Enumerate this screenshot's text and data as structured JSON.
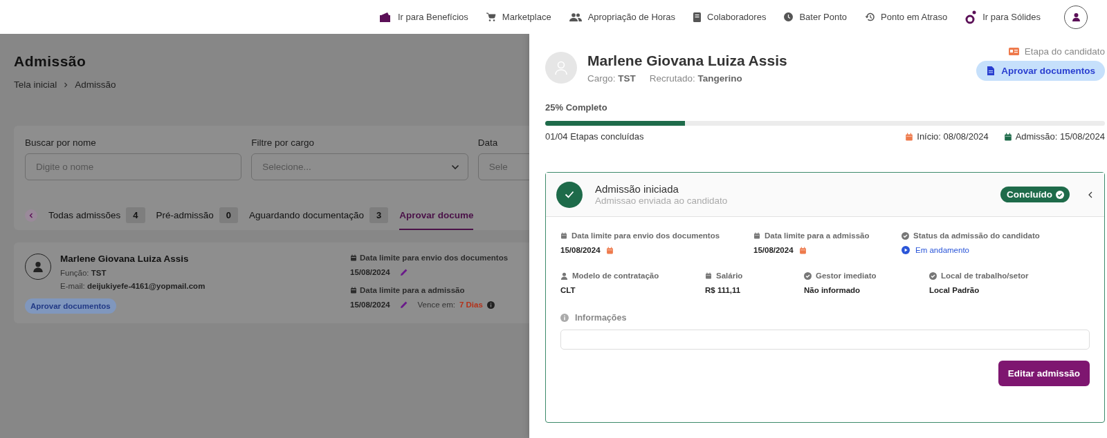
{
  "top_nav": {
    "links": [
      {
        "label": "Ir para Benefícios"
      },
      {
        "label": "Marketplace"
      },
      {
        "label": "Apropriação de Horas"
      },
      {
        "label": "Colaboradores"
      },
      {
        "label": "Bater Ponto"
      },
      {
        "label": "Ponto em Atraso"
      },
      {
        "label": "Ir para Sólides"
      }
    ]
  },
  "page": {
    "title": "Admissão",
    "breadcrumb": [
      "Tela inicial",
      "Admissão"
    ],
    "filters": [
      {
        "kind": "text",
        "label": "Buscar por nome",
        "placeholder": "Digite o nome"
      },
      {
        "kind": "select",
        "label": "Filtre por cargo",
        "placeholder": "Selecione..."
      },
      {
        "kind": "select",
        "label": "Data",
        "placeholder": "Sele"
      }
    ],
    "tabs": [
      {
        "label": "Todas admissões",
        "count": "4",
        "selected": false
      },
      {
        "label": "Pré-admissão",
        "count": "0",
        "selected": false
      },
      {
        "label": "Aguardando documentação",
        "count": "3",
        "selected": false
      },
      {
        "label": "Aprovar docume",
        "selected": true
      }
    ],
    "candidate_card": {
      "name": "Marlene Giovana Luiza Assis",
      "role": "Função: **TST**",
      "email": "E-mail: **deijukiyefe-4161@yopmail.com**",
      "status": "Aprovar documentos",
      "deadlines": [
        {
          "label": "Data limite para envio dos documentos",
          "date": "15/08/2024"
        },
        {
          "label": "Data limite para a admissão",
          "date": "15/08/2024",
          "due_label": "Vence em:",
          "due_value": "7 Dias"
        }
      ]
    }
  },
  "drawer": {
    "name": "Marlene Giovana Luiza Assis",
    "cargo": "Cargo: **TST**",
    "recruiter": "Recrutado: **Tangerino**",
    "stage_label": "Etapa do candidato",
    "stage_button": "Aprovar documentos",
    "progress": {
      "label": "25% Completo",
      "level": 0.25,
      "steps": "01/04 Etapas concluídas",
      "start": "Início: 08/08/2024",
      "admission": "Admissão: 15/08/2024"
    },
    "step": {
      "title": "Admissão iniciada",
      "subtitle": "Admissao enviada ao candidato",
      "status": "Concluído",
      "done": true,
      "expanded": true,
      "field_rows": [
        [
          {
            "kind": "date",
            "label": "Data limite para envio dos documentos",
            "value": "15/08/2024"
          },
          {
            "kind": "date",
            "label": "Data limite para a admissão",
            "value": "15/08/2024"
          },
          {
            "kind": "status",
            "label": "Status da admissão do candidato",
            "value": "Em andamento"
          }
        ],
        [
          {
            "kind": "text",
            "label": "Modelo de contratação",
            "value": "CLT"
          },
          {
            "kind": "text",
            "label": "Salário",
            "value": "R$ 111,11"
          },
          {
            "kind": "text",
            "label": "Gestor imediato",
            "value": "Não informado"
          },
          {
            "kind": "text",
            "label": "Local de trabalho/setor",
            "value": "Local Padrão"
          }
        ]
      ],
      "info_label": "Informações",
      "button": "Editar admissão"
    }
  }
}
